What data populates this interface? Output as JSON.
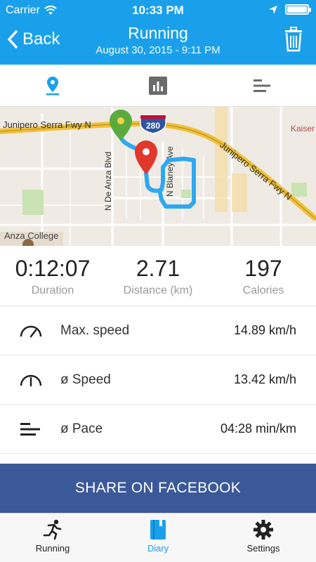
{
  "status_bar": {
    "carrier": "Carrier",
    "time": "10:33 PM",
    "battery_level": 1.0
  },
  "header": {
    "back_label": "Back",
    "title": "Running",
    "subtitle": "August 30, 2015 - 9:11 PM",
    "background_color": "#1aa0ea"
  },
  "tabs": [
    {
      "name": "map",
      "icon": "map-pin-icon",
      "active": true
    },
    {
      "name": "chart",
      "icon": "bar-chart-icon",
      "active": false
    },
    {
      "name": "list",
      "icon": "list-icon",
      "active": false
    }
  ],
  "map": {
    "labels": {
      "freeway_left": "Junipero Serra Fwy N",
      "freeway_right": "Junipero Serra Fwy N",
      "shield": "280",
      "street_1": "N De Anza Blvd",
      "street_2": "N Blaney Ave",
      "college": "Anza College",
      "kaiser": "Kaiser Med Ce"
    },
    "route_color": "#2ea8f0",
    "start_pin_color": "#5aab3c",
    "end_pin_color": "#e2372c"
  },
  "stats": [
    {
      "value": "0:12:07",
      "label": "Duration"
    },
    {
      "value": "2.71",
      "label": "Distance (km)"
    },
    {
      "value": "197",
      "label": "Calories"
    }
  ],
  "details": [
    {
      "icon": "speedometer-max-icon",
      "name": "Max. speed",
      "value": "14.89 km/h"
    },
    {
      "icon": "speedometer-icon",
      "name": "ø Speed",
      "value": "13.42 km/h"
    },
    {
      "icon": "pace-icon",
      "name": "ø Pace",
      "value": "04:28 min/km"
    }
  ],
  "share_button": {
    "label": "SHARE ON FACEBOOK",
    "color": "#3b5998"
  },
  "bottom_tabs": [
    {
      "label": "Running",
      "icon": "runner-icon",
      "active": false
    },
    {
      "label": "Diary",
      "icon": "diary-icon",
      "active": true
    },
    {
      "label": "Settings",
      "icon": "gear-icon",
      "active": false
    }
  ]
}
